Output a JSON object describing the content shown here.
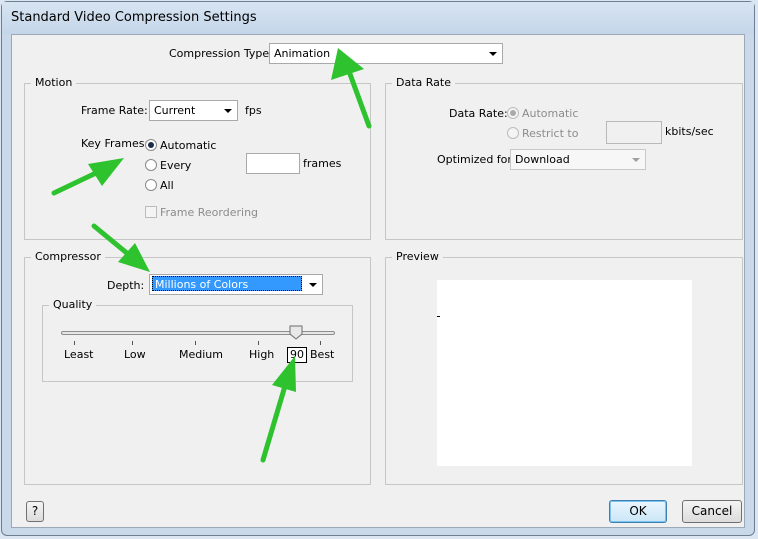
{
  "window": {
    "title": "Standard Video Compression Settings"
  },
  "compression_type": {
    "label": "Compression Type:",
    "value": "Animation"
  },
  "motion": {
    "title": "Motion",
    "frame_rate_label": "Frame Rate:",
    "frame_rate_value": "Current",
    "fps_label": "fps",
    "key_frames_label": "Key Frames:",
    "kf_automatic": "Automatic",
    "kf_every": "Every",
    "kf_all": "All",
    "frames_label": "frames",
    "frame_reordering": "Frame Reordering",
    "selected_key_frames": "Automatic"
  },
  "data_rate": {
    "title": "Data Rate",
    "label": "Data Rate:",
    "automatic": "Automatic",
    "restrict_to": "Restrict to",
    "units": "kbits/sec",
    "optimized_label": "Optimized for:",
    "optimized_value": "Download"
  },
  "compressor": {
    "title": "Compressor",
    "depth_label": "Depth:",
    "depth_value": "Millions of Colors",
    "quality": {
      "title": "Quality",
      "ticks": [
        "Least",
        "Low",
        "Medium",
        "High",
        "Best"
      ],
      "value": "90",
      "level_fraction": 0.9
    }
  },
  "preview": {
    "title": "Preview"
  },
  "buttons": {
    "help": "?",
    "ok": "OK",
    "cancel": "Cancel"
  },
  "colors": {
    "selection": "#3399ff",
    "annotation_arrow": "#2ec22e"
  }
}
